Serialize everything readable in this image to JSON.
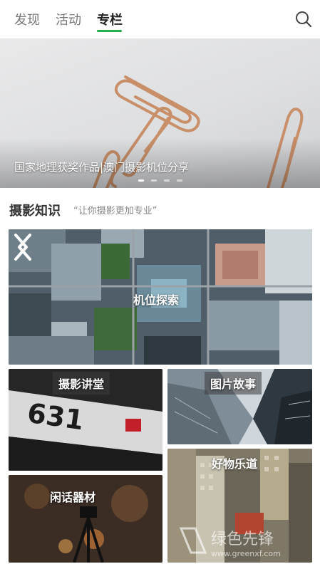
{
  "nav": {
    "tabs": [
      {
        "label": "发现"
      },
      {
        "label": "活动"
      },
      {
        "label": "专栏"
      }
    ],
    "active_tab": "专栏",
    "accent_color": "#22b14c"
  },
  "banner": {
    "caption": "国家地理获奖作品|澳门摄影机位分享",
    "slide_count": 4,
    "active_slide": 1
  },
  "section": {
    "title": "摄影知识",
    "subtitle": "“让你摄影更加专业”"
  },
  "cards": {
    "main": {
      "label": "机位探索"
    },
    "lecture": {
      "label": "摄影讲堂"
    },
    "story": {
      "label": "图片故事"
    },
    "gear": {
      "label": "闲话器材"
    },
    "goods": {
      "label": "好物乐道"
    }
  },
  "photo_text": {
    "number_sign": "631"
  },
  "watermark": {
    "text": "绿色先锋",
    "url": "www.greenxf.com"
  },
  "icons": [
    "search-icon",
    "chevron-left-icon",
    "chevron-right-icon"
  ]
}
